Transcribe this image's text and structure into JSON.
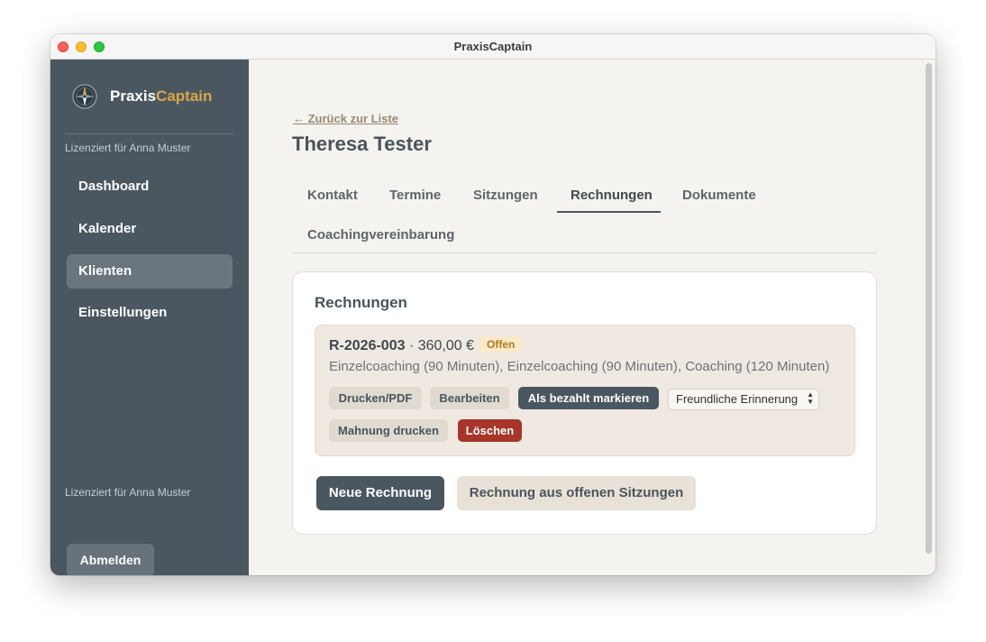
{
  "window": {
    "title": "PraxisCaptain"
  },
  "sidebar": {
    "brand_part1": "Praxis",
    "brand_part2": "Captain",
    "license_top": "Lizenziert für Anna Muster",
    "license_bottom": "Lizenziert für Anna Muster",
    "items": [
      {
        "label": "Dashboard",
        "active": false
      },
      {
        "label": "Kalender",
        "active": false
      },
      {
        "label": "Klienten",
        "active": true
      },
      {
        "label": "Einstellungen",
        "active": false
      }
    ],
    "logout_label": "Abmelden"
  },
  "main": {
    "back_link": "← Zurück zur Liste",
    "title": "Theresa Tester",
    "tabs": [
      {
        "label": "Kontakt"
      },
      {
        "label": "Termine"
      },
      {
        "label": "Sitzungen"
      },
      {
        "label": "Rechnungen",
        "active": true
      },
      {
        "label": "Dokumente"
      },
      {
        "label": "Coachingvereinbarung"
      }
    ]
  },
  "invoices_card": {
    "title": "Rechnungen",
    "invoice": {
      "number": "R-2026-003",
      "separator": " · ",
      "amount": "360,00 €",
      "status": "Offen",
      "description": "Einzelcoaching (90 Minuten), Einzelcoaching (90 Minuten), Coaching (120 Minuten)",
      "actions": {
        "print": "Drucken/PDF",
        "edit": "Bearbeiten",
        "mark_paid": "Als bezahlt markieren",
        "reminder_select": "Freundliche Erinnerung",
        "dunning_print": "Mahnung drucken",
        "delete": "Löschen"
      }
    },
    "new_invoice": "Neue Rechnung",
    "invoice_from_sessions": "Rechnung aus offenen Sitzungen"
  },
  "colors": {
    "sidebar_bg": "#4b5760",
    "brand_accent": "#d9a74a",
    "delete_red": "#a8352a",
    "status_open": "#b07a1c"
  }
}
